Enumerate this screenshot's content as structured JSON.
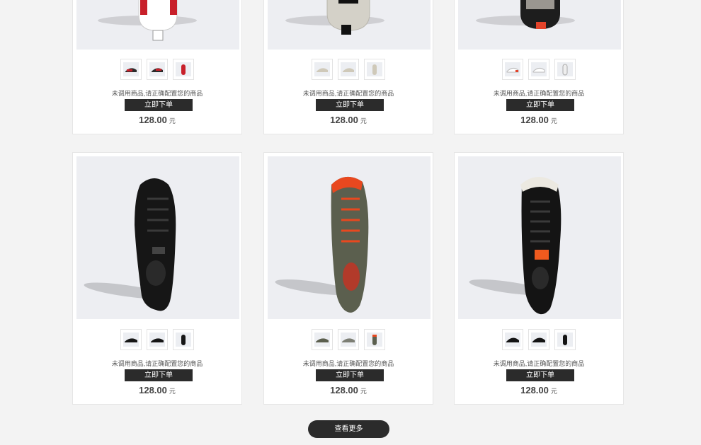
{
  "products": [
    {
      "desc": "未调用商品,请正确配置您的商品",
      "buy_label": "立即下单",
      "price": "128.00",
      "unit": "元",
      "accent": "#c8202a",
      "body": "#ffffff"
    },
    {
      "desc": "未调用商品,请正确配置您的商品",
      "buy_label": "立即下单",
      "price": "128.00",
      "unit": "元",
      "accent": "#111111",
      "body": "#d4d1c8"
    },
    {
      "desc": "未调用商品,请正确配置您的商品",
      "buy_label": "立即下单",
      "price": "128.00",
      "unit": "元",
      "accent": "#e2432a",
      "body": "#1d1d1d"
    },
    {
      "desc": "未调用商品,请正确配置您的商品",
      "buy_label": "立即下单",
      "price": "128.00",
      "unit": "元",
      "accent": "#444444",
      "body": "#161616"
    },
    {
      "desc": "未调用商品,请正确配置您的商品",
      "buy_label": "立即下单",
      "price": "128.00",
      "unit": "元",
      "accent": "#e8481f",
      "body": "#5b5f4e"
    },
    {
      "desc": "未调用商品,请正确配置您的商品",
      "buy_label": "立即下单",
      "price": "128.00",
      "unit": "元",
      "accent": "#ef5a1e",
      "body": "#141414"
    }
  ],
  "load_more_label": "查看更多"
}
